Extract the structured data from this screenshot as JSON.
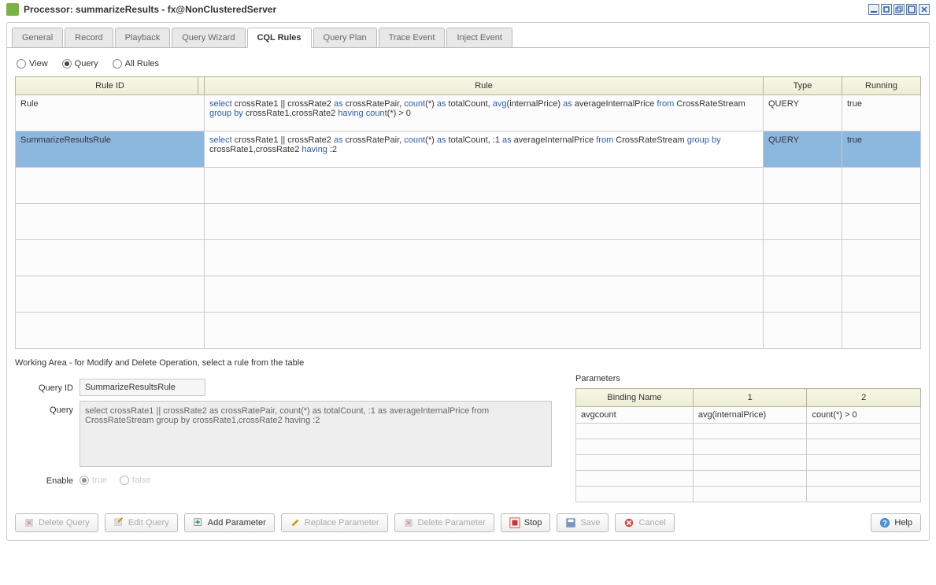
{
  "titlebar": {
    "title": "Processor: summarizeResults - fx@NonClusteredServer"
  },
  "tabs": {
    "items": [
      {
        "label": "General"
      },
      {
        "label": "Record"
      },
      {
        "label": "Playback"
      },
      {
        "label": "Query Wizard"
      },
      {
        "label": "CQL Rules"
      },
      {
        "label": "Query Plan"
      },
      {
        "label": "Trace Event"
      },
      {
        "label": "Inject Event"
      }
    ]
  },
  "radios": {
    "view": "View",
    "query": "Query",
    "allrules": "All Rules"
  },
  "grid": {
    "headers": {
      "ruleid": "Rule ID",
      "rule": "Rule",
      "type": "Type",
      "running": "Running"
    },
    "rows": [
      {
        "id": "Rule",
        "rule_tokens": [
          {
            "t": "select",
            "k": true
          },
          {
            "t": " crossRate1 || crossRate2 "
          },
          {
            "t": "as",
            "k": true
          },
          {
            "t": " crossRatePair, "
          },
          {
            "t": "count",
            "k": true
          },
          {
            "t": "(*) "
          },
          {
            "t": "as",
            "k": true
          },
          {
            "t": " totalCount, "
          },
          {
            "t": "avg",
            "k": true
          },
          {
            "t": "(internalPrice) "
          },
          {
            "t": "as",
            "k": true
          },
          {
            "t": " averageInternalPrice "
          },
          {
            "t": "from",
            "k": true
          },
          {
            "t": " CrossRateStream "
          },
          {
            "t": "group by",
            "k": true
          },
          {
            "t": " crossRate1,crossRate2 "
          },
          {
            "t": "having",
            "k": true
          },
          {
            "t": " "
          },
          {
            "t": "count",
            "k": true
          },
          {
            "t": "(*) > 0"
          }
        ],
        "type": "QUERY",
        "running": "true",
        "sel": false
      },
      {
        "id": "SummarizeResultsRule",
        "rule_tokens": [
          {
            "t": "select",
            "k": true
          },
          {
            "t": " crossRate1 || crossRate2 "
          },
          {
            "t": "as",
            "k": true
          },
          {
            "t": " crossRatePair, "
          },
          {
            "t": "count",
            "k": true
          },
          {
            "t": "(*) "
          },
          {
            "t": "as",
            "k": true
          },
          {
            "t": " totalCount, :1 "
          },
          {
            "t": "as",
            "k": true
          },
          {
            "t": " averageInternalPrice "
          },
          {
            "t": "from",
            "k": true
          },
          {
            "t": " CrossRateStream "
          },
          {
            "t": "group by",
            "k": true
          },
          {
            "t": " crossRate1,crossRate2 "
          },
          {
            "t": "having",
            "k": true
          },
          {
            "t": " :2"
          }
        ],
        "type": "QUERY",
        "running": "true",
        "sel": true
      }
    ]
  },
  "working_label": "Working Area - for Modify and Delete Operation, select a rule from the table",
  "form": {
    "queryid_label": "Query ID",
    "queryid_value": "SummarizeResultsRule",
    "query_label": "Query",
    "query_value": "select crossRate1 || crossRate2 as crossRatePair, count(*) as totalCount, :1 as averageInternalPrice from CrossRateStream group by crossRate1,crossRate2 having :2",
    "enable_label": "Enable",
    "enable_true": "true",
    "enable_false": "false"
  },
  "params": {
    "label": "Parameters",
    "headers": {
      "name": "Binding Name",
      "c1": "1",
      "c2": "2"
    },
    "rows": [
      {
        "name": "avgcount",
        "c1": "avg(internalPrice)",
        "c2": "count(*) > 0"
      }
    ]
  },
  "buttons": {
    "delete_query": "Delete Query",
    "edit_query": "Edit Query",
    "add_param": "Add Parameter",
    "replace_param": "Replace Parameter",
    "delete_param": "Delete Parameter",
    "stop": "Stop",
    "save": "Save",
    "cancel": "Cancel",
    "help": "Help"
  }
}
